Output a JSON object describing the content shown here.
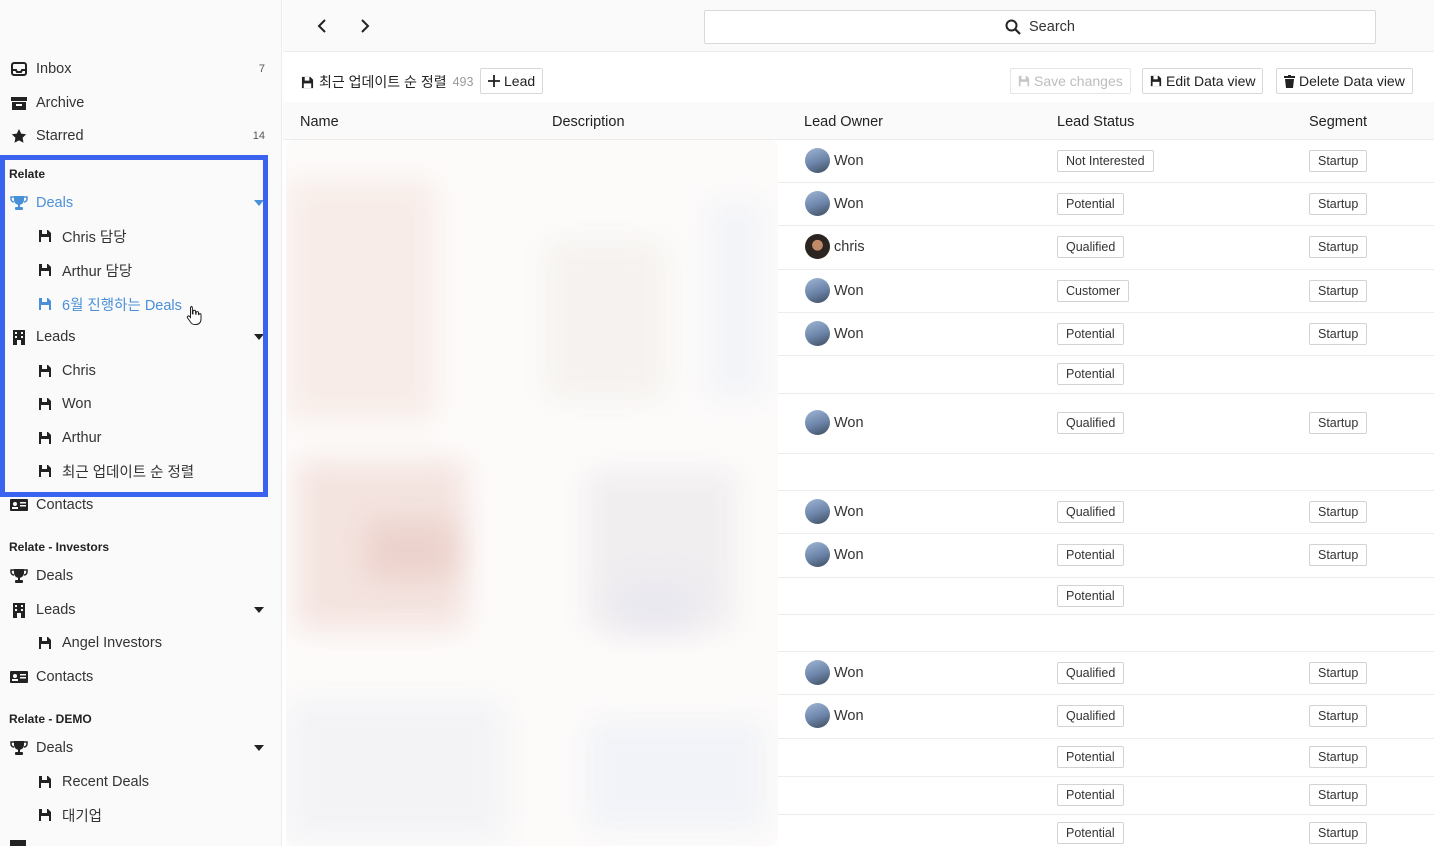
{
  "sidebar": {
    "top_items": [
      {
        "label": "Inbox",
        "count": "7",
        "icon": "inbox-icon"
      },
      {
        "label": "Archive",
        "icon": "archive-icon"
      },
      {
        "label": "Starred",
        "count": "14",
        "icon": "star-icon"
      }
    ],
    "sections": [
      {
        "title": "Relate",
        "deals": {
          "label": "Deals",
          "icon": "trophy-icon",
          "children": [
            "Chris 담당",
            "Arthur 담당",
            "6월 진행하는 Deals"
          ]
        },
        "leads": {
          "label": "Leads",
          "icon": "building-icon",
          "children": [
            "Chris",
            "Won",
            "Arthur",
            "최근 업데이트 순 정렬"
          ]
        },
        "contacts": {
          "label": "Contacts",
          "icon": "contact-card-icon"
        }
      },
      {
        "title": "Relate - Investors",
        "deals": {
          "label": "Deals",
          "icon": "trophy-icon"
        },
        "leads": {
          "label": "Leads",
          "icon": "building-icon",
          "children": [
            "Angel Investors"
          ]
        },
        "contacts": {
          "label": "Contacts",
          "icon": "contact-card-icon"
        }
      },
      {
        "title": "Relate - DEMO",
        "deals": {
          "label": "Deals",
          "icon": "trophy-icon",
          "children": [
            "Recent Deals",
            "대기업"
          ]
        }
      }
    ]
  },
  "topbar": {
    "search_label": "Search"
  },
  "toolbar": {
    "view_name": "최근 업데이트 순 정렬",
    "view_count": "493",
    "add_lead_label": "Lead",
    "save_changes_label": "Save changes",
    "edit_view_label": "Edit Data view",
    "delete_view_label": "Delete Data view"
  },
  "table": {
    "columns": [
      "Name",
      "Description",
      "Lead Owner",
      "Lead Status",
      "Segment"
    ],
    "rows": [
      {
        "owner": "Won",
        "status": "Not Interested",
        "segment": "Startup"
      },
      {
        "owner": "Won",
        "status": "Potential",
        "segment": "Startup"
      },
      {
        "owner": "chris",
        "status": "Qualified",
        "segment": "Startup"
      },
      {
        "owner": "Won",
        "status": "Customer",
        "segment": "Startup"
      },
      {
        "owner": "Won",
        "status": "Potential",
        "segment": "Startup"
      },
      {
        "owner": "",
        "status": "Potential",
        "segment": ""
      },
      {
        "owner": "Won",
        "status": "Qualified",
        "segment": "Startup"
      },
      {
        "owner": "",
        "status": "",
        "segment": ""
      },
      {
        "owner": "Won",
        "status": "Qualified",
        "segment": "Startup"
      },
      {
        "owner": "Won",
        "status": "Potential",
        "segment": "Startup"
      },
      {
        "owner": "",
        "status": "Potential",
        "segment": ""
      },
      {
        "owner": "",
        "status": "",
        "segment": ""
      },
      {
        "owner": "Won",
        "status": "Qualified",
        "segment": "Startup"
      },
      {
        "owner": "Won",
        "status": "Qualified",
        "segment": "Startup"
      },
      {
        "owner": "",
        "status": "Potential",
        "segment": "Startup"
      },
      {
        "owner": "",
        "status": "Potential",
        "segment": "Startup"
      },
      {
        "owner": "",
        "status": "Potential",
        "segment": "Startup"
      }
    ]
  },
  "colors": {
    "accent": "#4a90d9",
    "highlight_border": "#3a63f0"
  }
}
